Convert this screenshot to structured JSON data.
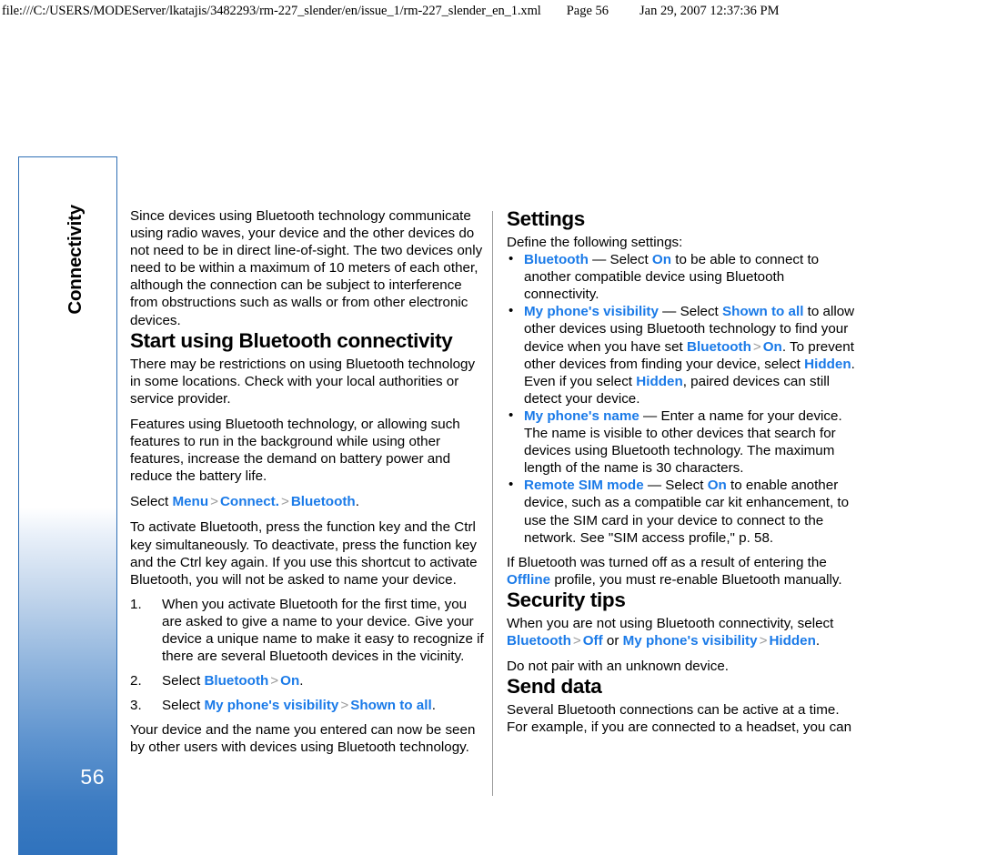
{
  "print_header": {
    "url": "file:///C:/USERS/MODEServer/lkatajis/3482293/rm-227_slender/en/issue_1/rm-227_slender_en_1.xml",
    "page": "Page 56",
    "date": "Jan 29, 2007 12:37:36 PM"
  },
  "sidebar": {
    "chapter_title": "Connectivity",
    "page_number": "56",
    "accent_color": "#2f72bd",
    "border_color": "#2f6fb5"
  },
  "theme": {
    "link_color": "#1a7ae8",
    "chevron_color": "#9a9a9a",
    "text_color": "#000000"
  },
  "left_column": {
    "intro_paragraph": "Since devices using Bluetooth technology communicate using radio waves, your device and the other devices do not need to be in direct line-of-sight. The two devices only need to be within a maximum of 10 meters of each other, although the connection can be subject to interference from obstructions such as walls or from other electronic devices.",
    "heading_start": "Start using Bluetooth connectivity",
    "para_restrictions": "There may be restrictions on using Bluetooth technology in some locations. Check with your local authorities or service provider.",
    "para_features": "Features using Bluetooth technology, or allowing such features to run in the background while using other features, increase the demand on battery power and reduce the battery life.",
    "select_path": {
      "lead": "Select ",
      "item1": "Menu",
      "item2": "Connect.",
      "item3": "Bluetooth",
      "period": "."
    },
    "para_activate": "To activate Bluetooth, press the function key and the Ctrl key simultaneously. To deactivate, press the function key and the Ctrl key again. If you use this shortcut to activate Bluetooth, you will not be asked to name your device.",
    "steps": [
      {
        "number": "1.",
        "text": "When you activate Bluetooth for the first time, you are asked to give a name to your device. Give your device a unique name to make it easy to recognize if there are several Bluetooth devices in the vicinity."
      },
      {
        "number": "2.",
        "lead": "Select ",
        "item1": "Bluetooth",
        "item2": "On",
        "period": "."
      },
      {
        "number": "3.",
        "lead": "Select ",
        "item1": "My phone's visibility",
        "item2": "Shown to all",
        "period": "."
      }
    ],
    "para_seen": "Your device and the name you entered can now be seen by other users with devices using Bluetooth technology."
  },
  "right_column": {
    "heading_settings": "Settings",
    "para_define": "Define the following settings:",
    "bullets": [
      {
        "bullet": "•",
        "term": "Bluetooth",
        "t1": " — Select ",
        "v1": "On",
        "t2": " to be able to connect to another compatible device using Bluetooth connectivity."
      },
      {
        "bullet": "•",
        "term": "My phone's visibility",
        "t1": " — Select ",
        "v1": "Shown to all",
        "t2": " to allow other devices using Bluetooth technology to find your device when you have set ",
        "v2": "Bluetooth",
        "t3": "",
        "v3": "On",
        "t4": ". To prevent other devices from finding your device, select ",
        "v4": "Hidden",
        "t5": ". Even if you select ",
        "v5": "Hidden",
        "t6": ", paired devices can still detect your device."
      },
      {
        "bullet": "•",
        "term": "My phone's name",
        "t1": " — Enter a name for your device. The name is visible to other devices that search for devices using Bluetooth technology. The maximum length of the name is 30 characters."
      },
      {
        "bullet": "•",
        "term": "Remote SIM mode",
        "t1": " — Select ",
        "v1": "On",
        "t2": " to enable another device, such as a compatible car kit enhancement, to use the SIM card in your device to connect to the network. See \"SIM access profile,\" p. 58."
      }
    ],
    "para_offline": {
      "t1": "If Bluetooth was turned off as a result of entering the ",
      "v1": "Offline",
      "t2": " profile, you must re-enable Bluetooth manually."
    },
    "heading_security": "Security tips",
    "para_security": {
      "t1": "When you are not using Bluetooth connectivity, select ",
      "v1": "Bluetooth",
      "v2": "Off",
      "t2": " or ",
      "v3": "My phone's visibility",
      "v4": "Hidden",
      "t3": "."
    },
    "para_nopair": "Do not pair with an unknown device.",
    "heading_send": "Send data",
    "para_send": "Several Bluetooth connections can be active at a time. For example, if you are connected to a headset, you can"
  }
}
